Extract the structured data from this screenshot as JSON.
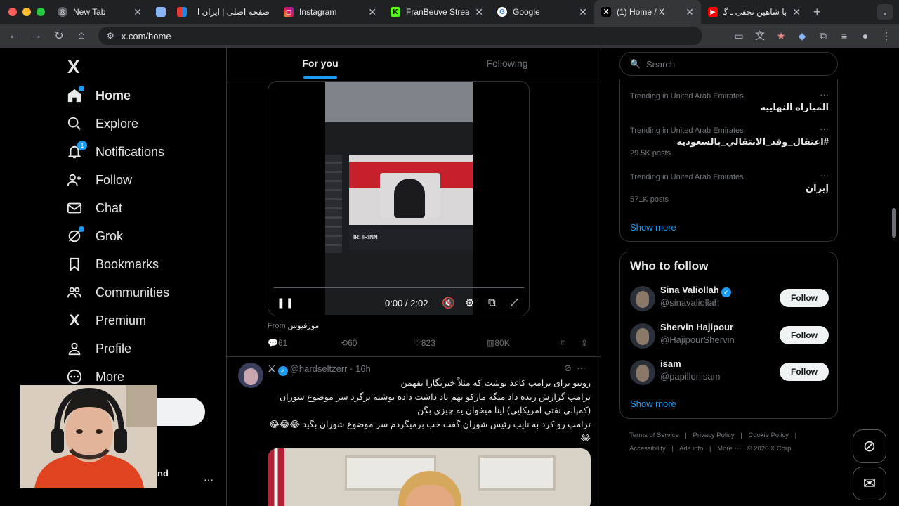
{
  "browser": {
    "tabs": [
      {
        "title": "New Tab",
        "icon": "chrome-icon"
      },
      {
        "title": "",
        "icon": "extension-icon"
      },
      {
        "title": "صفحه اصلی | ایران ا",
        "icon": "site-icon"
      },
      {
        "title": "Instagram",
        "icon": "instagram-icon"
      },
      {
        "title": "FranBeuve Stream",
        "icon": "kick-icon"
      },
      {
        "title": "Google",
        "icon": "google-icon"
      },
      {
        "title": "(1) Home / X",
        "icon": "x-icon"
      },
      {
        "title": "با شاهین نجفی ـ گفت",
        "icon": "youtube-icon"
      }
    ],
    "url": "x.com/home"
  },
  "nav": {
    "logo": "X",
    "items": [
      {
        "label": "Home",
        "icon": "home-icon"
      },
      {
        "label": "Explore",
        "icon": "search-icon"
      },
      {
        "label": "Notifications",
        "icon": "bell-icon",
        "badge": "1"
      },
      {
        "label": "Follow",
        "icon": "person-add-icon"
      },
      {
        "label": "Chat",
        "icon": "mail-icon"
      },
      {
        "label": "Grok",
        "icon": "grok-icon"
      },
      {
        "label": "Bookmarks",
        "icon": "bookmark-icon"
      },
      {
        "label": "Communities",
        "icon": "people-icon"
      },
      {
        "label": "Premium",
        "icon": "x-icon"
      },
      {
        "label": "Profile",
        "icon": "person-icon"
      },
      {
        "label": "More",
        "icon": "more-icon"
      }
    ],
    "account_name_tail": "nd",
    "account_more": "···"
  },
  "main": {
    "tabs": [
      "For you",
      "Following"
    ],
    "video": {
      "time": "0:00 / 2:02",
      "banner": "IR: IRINN",
      "progress": 0
    },
    "from_label": "From",
    "from_name": "مورفيوس",
    "actions": {
      "replies": "61",
      "reposts": "60",
      "likes": "823",
      "views": "80K"
    },
    "post": {
      "handle": "@hardseltzerr",
      "time": "16h",
      "lines": [
        "روبیو برای ترامپ کاغذ نوشت که مثلاً خبرنگارا نفهمن",
        "ترامپ گزارش زنده داد میگه مارکو بهم یاد داشت داده نوشته برگرد سر موضوع شوران",
        "(کمپانی نفتی امریکایی) اینا میخوان یه چیزی بگن",
        "ترامپ رو کرد به نایب رئیس شوران گفت خب برمیگردم سر موضوع شوران بگید 😂😂😂",
        "😂"
      ]
    }
  },
  "sidebar": {
    "search_placeholder": "Search",
    "trends": [
      {
        "meta": "Trending in United Arab Emirates",
        "name": "المباراه النهاييه",
        "count": ""
      },
      {
        "meta": "Trending in United Arab Emirates",
        "name": "#اعتقال_وفد_الانتقالي_بالسعوديه",
        "count": "29.5K posts"
      },
      {
        "meta": "Trending in United Arab Emirates",
        "name": "إيران",
        "count": "571K posts"
      }
    ],
    "show_more": "Show more",
    "who_to_follow": {
      "title": "Who to follow",
      "people": [
        {
          "name": "Sina Valiollah",
          "handle": "@sinavaliollah",
          "verified": true,
          "button": "Follow"
        },
        {
          "name": "Shervin Hajipour",
          "handle": "@HajipourShervin",
          "verified": false,
          "button": "Follow"
        },
        {
          "name": "isam",
          "handle": "@papillonisam",
          "verified": false,
          "button": "Follow"
        }
      ],
      "show_more": "Show more"
    },
    "footer": [
      "Terms of Service",
      "|",
      "Privacy Policy",
      "|",
      "Cookie Policy",
      "|",
      "Accessibility",
      "|",
      "Ads info",
      "|",
      "More ···",
      "© 2026 X Corp."
    ]
  },
  "colors": {
    "accent": "#1d9bf0",
    "background": "#000000",
    "border": "#2f3336",
    "muted": "#71767b"
  }
}
